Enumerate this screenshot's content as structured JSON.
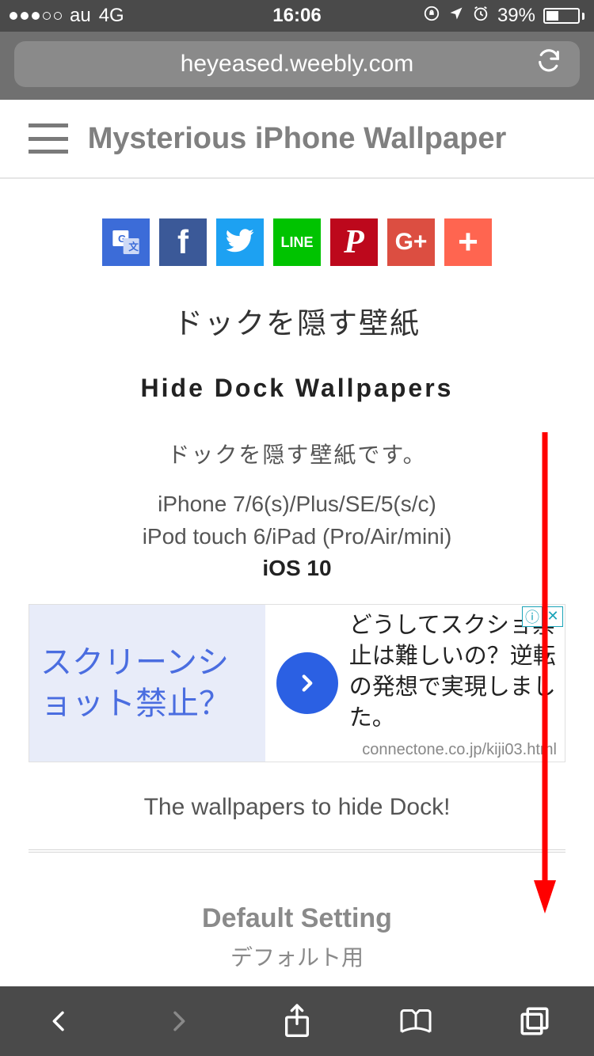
{
  "status": {
    "carrier": "au",
    "network": "4G",
    "time": "16:06",
    "battery_pct": "39%"
  },
  "browser": {
    "url": "heyeased.weebly.com"
  },
  "header": {
    "title": "Mysterious iPhone Wallpaper"
  },
  "share": {
    "translate": "G",
    "facebook": "f",
    "twitter": "",
    "line": "LINE",
    "pinterest": "P",
    "gplus": "G+",
    "addthis": "+"
  },
  "main": {
    "title_jp": "ドックを隠す壁紙",
    "title_en": "Hide Dock Wallpapers",
    "desc_jp": "ドックを隠す壁紙です。",
    "compat_line1": "iPhone 7/6(s)/Plus/SE/5(s/c)",
    "compat_line2": "iPod touch 6/iPad (Pro/Air/mini)",
    "compat_os": "iOS 10",
    "tagline_en": "The wallpapers to hide Dock!",
    "section_title": "Default Setting",
    "section_sub": "デフォルト用"
  },
  "ad": {
    "left_text": "スクリーンショット禁止？",
    "right_text": "どうしてスクショ禁止は難しいの？逆転の発想で実現しました。",
    "url": "connectone.co.jp/kiji03.html"
  }
}
